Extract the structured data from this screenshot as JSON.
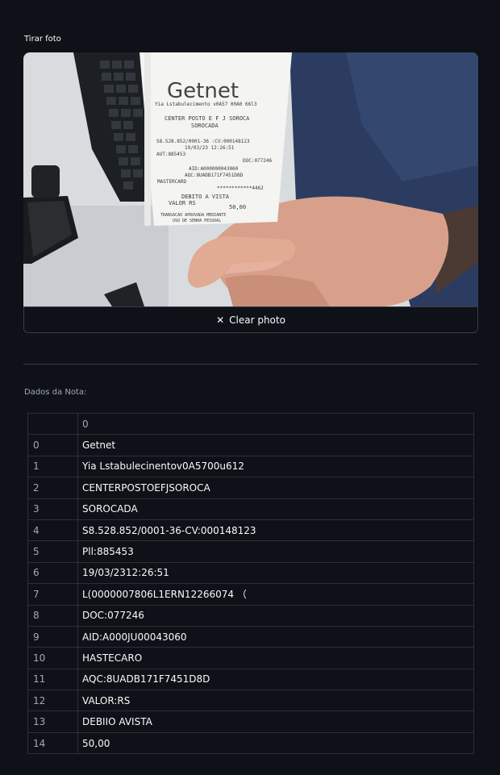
{
  "camera": {
    "label": "Tirar foto",
    "clear_button_label": "Clear photo",
    "clear_icon": "x-icon"
  },
  "receipt_photo": {
    "brand": "Getnet",
    "lines": [
      "Yia Lstabulecimento v0A57 00A0 66l3",
      "CENTER POSTO E F J SOROCA",
      "SOROCADA",
      "S8.528.852/0001-36 :CV:000148123",
      "19/03/23 12:26:51",
      "AUT:885453",
      "DOC:077246",
      "AID:A000000043060",
      "AQC:8UADB171F7451D8D",
      "MASTERCARD",
      "************4462",
      "DEBITO A VISTA",
      "VALOR RS",
      "50,00",
      "TRANSACAO APROVADA MEDIANTE",
      "USO DE SENHA PESSOAL"
    ]
  },
  "data_section": {
    "label": "Dados da Nota:",
    "column_header": "0",
    "rows": [
      {
        "index": "0",
        "value": "Getnet"
      },
      {
        "index": "1",
        "value": "Yia Lstabulecinentov0A5700u612"
      },
      {
        "index": "2",
        "value": "CENTERPOSTOEFJSOROCA"
      },
      {
        "index": "3",
        "value": "SOROCADA"
      },
      {
        "index": "4",
        "value": "S8.528.852/0001-36-CV:000148123"
      },
      {
        "index": "5",
        "value": "Pll:885453"
      },
      {
        "index": "6",
        "value": "19/03/2312:26:51"
      },
      {
        "index": "7",
        "value": "L(0000007806L1ERN12266074 （"
      },
      {
        "index": "8",
        "value": "DOC:077246"
      },
      {
        "index": "9",
        "value": "AID:A000JU00043060"
      },
      {
        "index": "10",
        "value": "HASTECARO"
      },
      {
        "index": "11",
        "value": "AQC:8UADB171F7451D8D"
      },
      {
        "index": "12",
        "value": "VALOR:RS"
      },
      {
        "index": "13",
        "value": "DEBIIO AVISTA"
      },
      {
        "index": "14",
        "value": "50,00"
      }
    ]
  }
}
